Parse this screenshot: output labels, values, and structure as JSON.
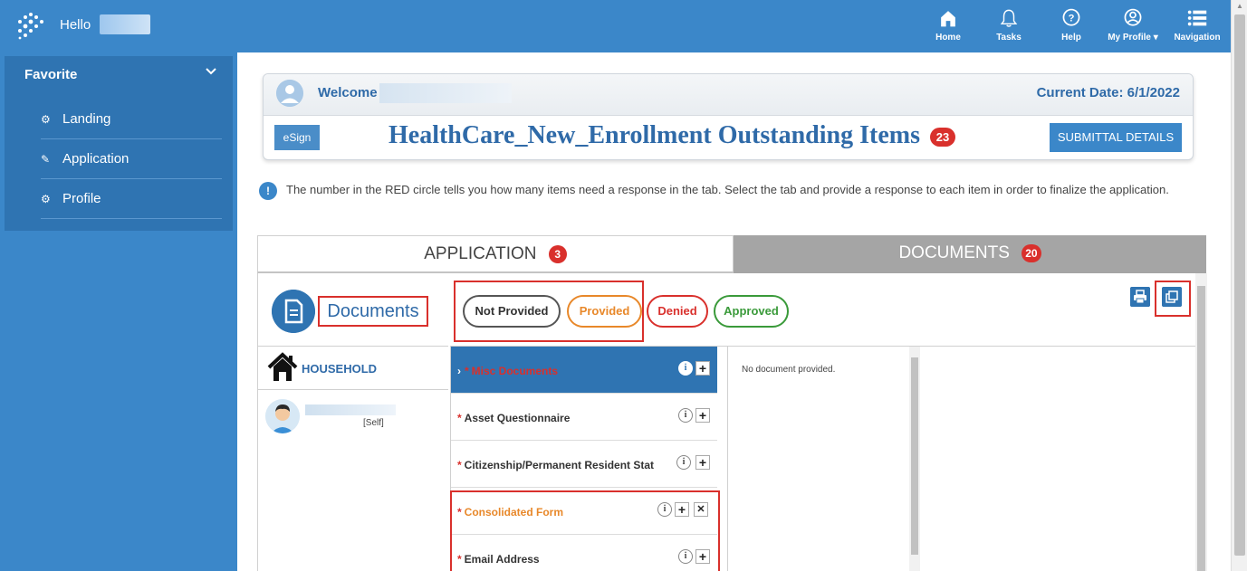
{
  "topbar": {
    "hello": "Hello",
    "nav": [
      {
        "label": "Home",
        "icon": "home-icon"
      },
      {
        "label": "Tasks",
        "icon": "bell-icon"
      },
      {
        "label": "Help",
        "icon": "help-icon"
      },
      {
        "label": "My Profile ▾",
        "icon": "profile-icon"
      },
      {
        "label": "Navigation",
        "icon": "menu-icon"
      }
    ]
  },
  "sidebar": {
    "section": "Favorite",
    "items": [
      {
        "label": "Landing",
        "icon": "gear-icon"
      },
      {
        "label": "Application",
        "icon": "edit-icon"
      },
      {
        "label": "Profile",
        "icon": "gear-icon"
      }
    ]
  },
  "welcome": {
    "welcome_label": "Welcome",
    "current_date": "Current Date: 6/1/2022",
    "esign_label": "eSign",
    "title": "HealthCare_New_Enrollment Outstanding Items",
    "title_count": "23",
    "submittal_label": "SUBMITTAL DETAILS"
  },
  "info": {
    "text": "The number in the RED circle tells you how many items need a response in the tab. Select the tab and provide a response to each item in order to finalize the application."
  },
  "tabs": [
    {
      "label": "APPLICATION",
      "count": "3"
    },
    {
      "label": "DOCUMENTS",
      "count": "20"
    }
  ],
  "documents": {
    "heading": "Documents",
    "statuses": {
      "not_provided": "Not Provided",
      "provided": "Provided",
      "denied": "Denied",
      "approved": "Approved"
    },
    "household_label": "HOUSEHOLD",
    "member_relation": "[Self]",
    "list": [
      {
        "name": "Misc Documents"
      },
      {
        "name": "Asset Questionnaire"
      },
      {
        "name": "Citizenship/Permanent Resident Stat"
      },
      {
        "name": "Consolidated Form"
      },
      {
        "name": "Email Address"
      }
    ],
    "detail_text": "No document provided."
  },
  "colors": {
    "brand_blue": "#3b87c9",
    "dark_blue": "#2f74b2",
    "red": "#d9302c",
    "orange": "#e8882a",
    "green": "#3a9a3a"
  }
}
